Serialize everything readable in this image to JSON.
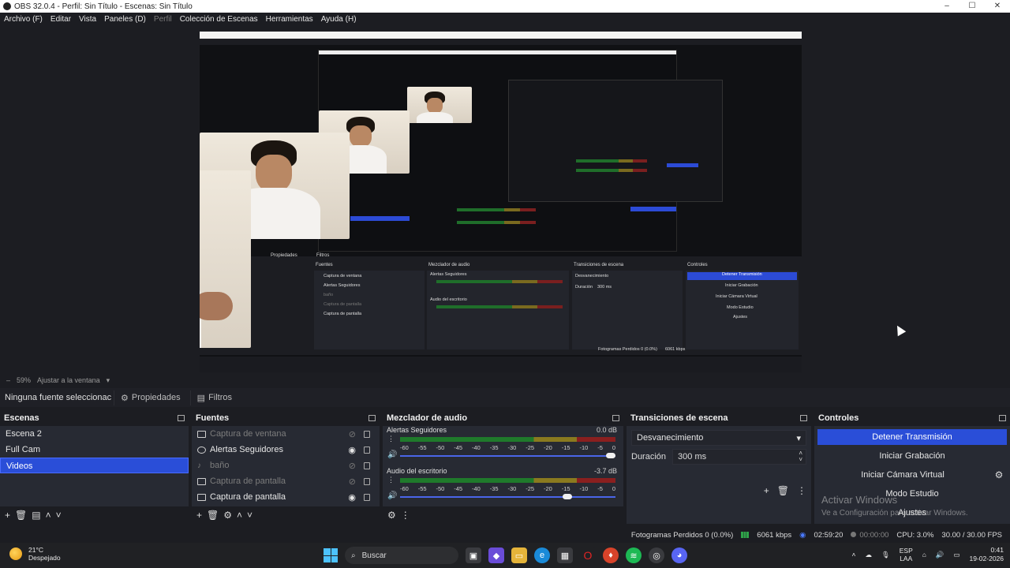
{
  "window": {
    "title": "OBS 32.0.4 - Perfil: Sin Título - Escenas: Sin Título",
    "controls": [
      "–",
      "☐",
      "✕"
    ]
  },
  "menu": [
    {
      "label": "Archivo (F)",
      "enabled": true
    },
    {
      "label": "Editar",
      "enabled": true
    },
    {
      "label": "Vista",
      "enabled": true
    },
    {
      "label": "Paneles (D)",
      "enabled": true
    },
    {
      "label": "Perfil",
      "enabled": false
    },
    {
      "label": "Colección de Escenas",
      "enabled": true
    },
    {
      "label": "Herramientas",
      "enabled": true
    },
    {
      "label": "Ayuda (H)",
      "enabled": true
    }
  ],
  "zoom": {
    "minus": "–",
    "value": "59%",
    "fit_label": "Ajustar a la ventana"
  },
  "source_toolbar": {
    "no_source": "Ninguna fuente seleccionac",
    "properties": "Propiedades",
    "filters": "Filtros"
  },
  "scenes": {
    "title": "Escenas",
    "items": [
      {
        "label": "Escena 2",
        "active": false
      },
      {
        "label": "Full Cam",
        "active": false
      },
      {
        "label": "Videos",
        "active": true
      }
    ]
  },
  "sources": {
    "title": "Fuentes",
    "items": [
      {
        "label": "Captura de ventana",
        "visible": false,
        "icon": "window-icon"
      },
      {
        "label": "Alertas Seguidores",
        "visible": true,
        "icon": "browser-icon"
      },
      {
        "label": "baño",
        "visible": false,
        "icon": "audio-icon"
      },
      {
        "label": "Captura de pantalla",
        "visible": false,
        "icon": "display-icon"
      },
      {
        "label": "Captura de pantalla",
        "visible": true,
        "icon": "display-icon"
      }
    ]
  },
  "mixer": {
    "title": "Mezclador de audio",
    "scale": [
      "-60",
      "-55",
      "-50",
      "-45",
      "-40",
      "-35",
      "-30",
      "-25",
      "-20",
      "-15",
      "-10",
      "-5",
      "0"
    ],
    "tracks": [
      {
        "name": "Alertas Seguidores",
        "db": "0.0 dB",
        "volume": 1.0
      },
      {
        "name": "Audio del escritorio",
        "db": "-3.7 dB",
        "volume": 0.8
      }
    ]
  },
  "transitions": {
    "title": "Transiciones de escena",
    "selected": "Desvanecimiento",
    "duration_label": "Duración",
    "duration_value": "300 ms"
  },
  "controls": {
    "title": "Controles",
    "stop_stream": "Detener Transmisión",
    "start_recording": "Iniciar Grabación",
    "start_virtual_cam": "Iniciar Cámara Virtual",
    "studio_mode": "Modo Estudio",
    "settings": "Ajustes"
  },
  "watermark": {
    "title": "Activar Windows",
    "subtitle": "Ve a Configuración para activar Windows."
  },
  "status": {
    "dropped_frames": "Fotogramas Perdidos 0 (0.0%)",
    "bitrate": "6061 kbps",
    "stream_time": "02:59:20",
    "rec_time": "00:00:00",
    "cpu": "CPU: 3.0%",
    "fps": "30.00 / 30.00 FPS"
  },
  "taskbar": {
    "temp": "21°C",
    "weather": "Despejado",
    "search_placeholder": "Buscar",
    "lang_top": "ESP",
    "lang_bottom": "LAA",
    "time": "0:41",
    "date": "19-02-2026"
  },
  "nested": {
    "panels": [
      "Fuentes",
      "Mezclador de audio",
      "Transiciones de escena",
      "Controles"
    ],
    "sources": [
      "Captura de ventana",
      "Alertas Seguidores",
      "baño",
      "Captura de pantalla",
      "Captura de pantalla"
    ],
    "stop": "Detener Transmisión",
    "rec": "Iniciar Grabación",
    "vcam": "Iniciar Cámara Virtual",
    "studio": "Modo Estudio",
    "settings": "Ajustes",
    "props": "Propiedades",
    "filters": "Filtros",
    "status": "Fotogramas Perdidos 0 (0.0%)",
    "bitrate": "6061 kbps",
    "trans": "Desvanecimiento",
    "dur": "Duración",
    "dur_value": "300 ms",
    "mix1": "Alertas Seguidores",
    "mix2": "Audio del escritorio"
  },
  "colors": {
    "accent": "#2a4ed8",
    "panel": "#272a33",
    "background": "#1c1d22"
  }
}
